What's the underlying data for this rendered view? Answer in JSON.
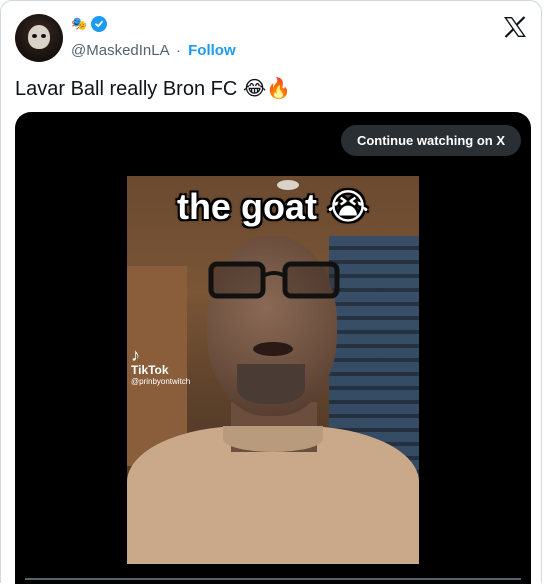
{
  "author": {
    "handle": "@MaskedInLA",
    "separator": "·",
    "follow_label": "Follow",
    "badge_icons": [
      "theater-masks-icon",
      "verified-icon"
    ]
  },
  "tweet": {
    "text": "Lavar Ball really Bron FC",
    "emojis": [
      "😂",
      "🔥"
    ]
  },
  "media": {
    "continue_label": "Continue watching on X",
    "overlay_text": "the goat",
    "overlay_emoji": "😭",
    "watermark_brand": "TikTok",
    "watermark_user": "@prinbyontwitch"
  },
  "colors": {
    "accent": "#1d9bf0",
    "secondary_text": "#536471",
    "media_bg": "#000000"
  }
}
